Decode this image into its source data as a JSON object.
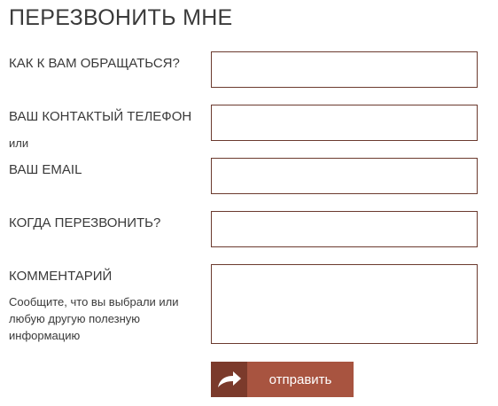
{
  "form": {
    "title": "ПЕРЕЗВОНИТЬ МНЕ",
    "name_label": "КАК К ВАМ ОБРАЩАТЬСЯ?",
    "name_value": "",
    "phone_label": "ВАШ КОНТАКТЫЙ ТЕЛЕФОН",
    "or_label": "или",
    "phone_value": "",
    "email_label": "ВАШ EMAIL",
    "email_value": "",
    "when_label": "КОГДА ПЕРЕЗВОНИТЬ?",
    "when_value": "",
    "comment_label": "КОММЕНТАРИЙ",
    "comment_hint": "Сообщите, что вы выбрали или любую другую полезную информацию",
    "comment_value": "",
    "submit_label": "отправить",
    "submit_icon": "share-arrow-icon"
  },
  "colors": {
    "border": "#6b3a2e",
    "button_icon_bg": "#7b3a2b",
    "button_bg": "#a85440",
    "button_text": "#ffffff"
  }
}
